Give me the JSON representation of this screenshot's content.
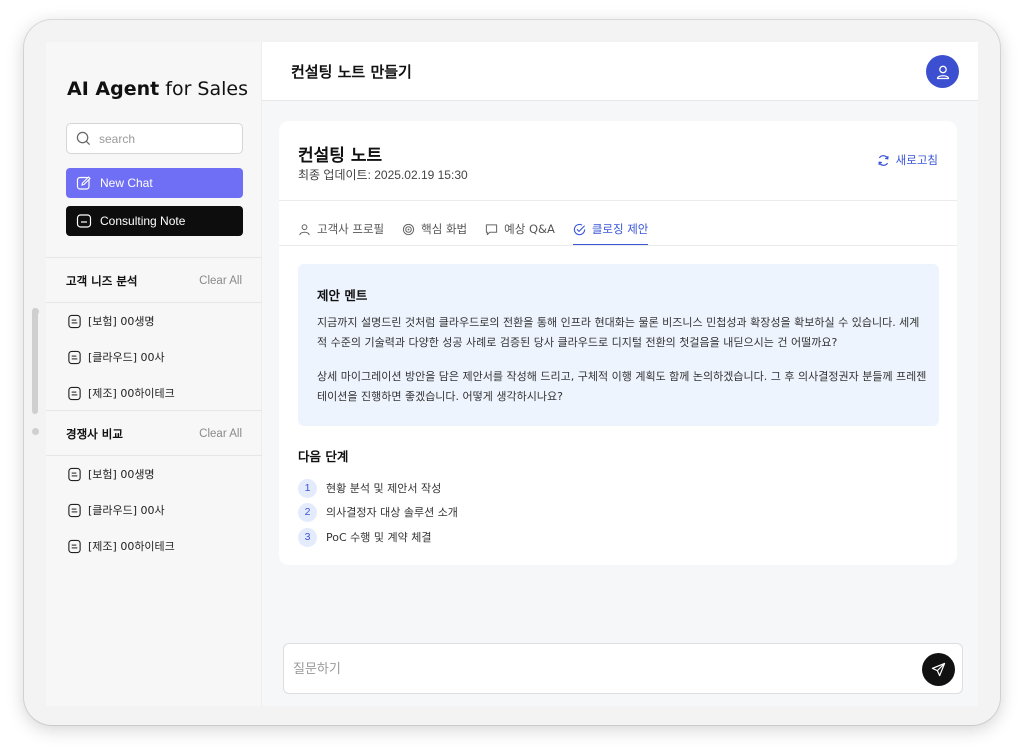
{
  "sidebar": {
    "brand_bold": "AI Agent",
    "brand_rest": "for Sales",
    "search_placeholder": "search",
    "new_chat_label": "New Chat",
    "consulting_note_label": "Consulting Note",
    "sections": [
      {
        "title": "고객 니즈 분석",
        "clear_label": "Clear All",
        "items": [
          {
            "label": "[보험] 00생명"
          },
          {
            "label": "[클라우드] 00사"
          },
          {
            "label": "[제조] 00하이테크"
          }
        ]
      },
      {
        "title": "경쟁사 비교",
        "clear_label": "Clear All",
        "items": [
          {
            "label": "[보험] 00생명"
          },
          {
            "label": "[클라우드] 00사"
          },
          {
            "label": "[제조] 00하이테크"
          }
        ]
      }
    ]
  },
  "header": {
    "title": "컨설팅 노트 만들기",
    "avatar_icon": "user-icon"
  },
  "note": {
    "title": "컨설팅 노트",
    "updated": "최종 업데이트: 2025.02.19 15:30",
    "refresh_label": "새로고침",
    "tabs": [
      {
        "label": "고객사 프로필",
        "icon": "person-icon",
        "active": false
      },
      {
        "label": "핵심 화법",
        "icon": "target-icon",
        "active": false
      },
      {
        "label": "예상 Q&A",
        "icon": "chat-bubble-icon",
        "active": false
      },
      {
        "label": "클로징 제안",
        "icon": "check-circle-icon",
        "active": true
      }
    ],
    "proposal": {
      "heading": "제안 멘트",
      "paragraph1": "지금까지 설명드린 것처럼 클라우드로의 전환을 통해 인프라 현대화는 물론 비즈니스 민첩성과 확장성을 확보하실 수 있습니다. 세계적 수준의 기술력과 다양한 성공 사례로 검증된 당사 클라우드로 디지털 전환의 첫걸음을 내딛으시는 건 어떨까요?",
      "paragraph2": "상세 마이그레이션 방안을 담은 제안서를 작성해 드리고, 구체적 이행 계획도 함께 논의하겠습니다. 그 후 의사결정권자 분들께 프레젠테이션을 진행하면 좋겠습니다. 어떻게 생각하시나요?"
    },
    "next_steps": {
      "heading": "다음 단계",
      "items": [
        {
          "num": "1",
          "label": "현황 분석 및 제안서 작성"
        },
        {
          "num": "2",
          "label": "의사결정자 대상 솔루션 소개"
        },
        {
          "num": "3",
          "label": "PoC 수행 및 계약 체결"
        }
      ]
    }
  },
  "chat": {
    "placeholder": "질문하기",
    "send_icon": "send-icon"
  },
  "colors": {
    "accent": "#3a56d8",
    "new_chat_bg": "#6f6ff5",
    "consulting_note_bg": "#0d0d0d",
    "avatar_bg": "#3b4fd0",
    "proposal_bg": "#eef4fe"
  }
}
